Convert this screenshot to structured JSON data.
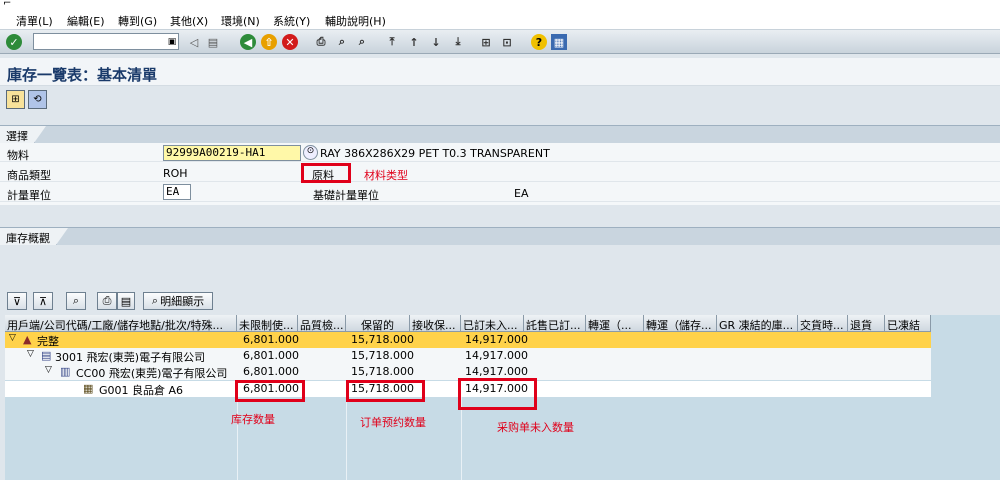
{
  "menu": [
    "清單(L)",
    "編輯(E)",
    "轉到(G)",
    "其他(X)",
    "環境(N)",
    "系統(Y)",
    "輔助說明(H)"
  ],
  "toolbar": {
    "command_field": ""
  },
  "page": {
    "title": "庫存一覽表：基本清單"
  },
  "selection": {
    "group_title": "選擇",
    "material_label": "物料",
    "material_value": "92999A00219-HA1",
    "material_desc": "RAY 386X286X29 PET T0.3 TRANSPARENT",
    "type_label": "商品類型",
    "type_value": "ROH",
    "type_text": "原料",
    "type_annotation": "材料类型",
    "unit_label": "計量單位",
    "unit_value": "EA",
    "base_unit_label": "基礎計量單位",
    "base_unit_value": "EA"
  },
  "overview": {
    "group_title": "庫存概觀",
    "detail_button": "明細顯示",
    "columns": [
      "用戶端/公司代碼/工廠/儲存地點/批次/特殊...",
      "未限制使...",
      "品質檢...",
      "保留的",
      "接收保...",
      "已訂未入...",
      "託售已訂...",
      "轉運（...",
      "轉運（儲存...",
      "GR 凍結的庫...",
      "交貨時...",
      "退貨",
      "已凍結"
    ],
    "rows": [
      {
        "label": "完整",
        "unrestricted": "6,801.000",
        "reserved": "15,718.000",
        "on_order": "14,917.000"
      },
      {
        "label": "3001 飛宏(東莞)電子有限公司",
        "unrestricted": "6,801.000",
        "reserved": "15,718.000",
        "on_order": "14,917.000"
      },
      {
        "label": "CC00 飛宏(東莞)電子有限公司",
        "unrestricted": "6,801.000",
        "reserved": "15,718.000",
        "on_order": "14,917.000"
      },
      {
        "label": "G001 良品倉 A6",
        "unrestricted": "6,801.000",
        "reserved": "15,718.000",
        "on_order": "14,917.000"
      }
    ],
    "annotations": {
      "stock": "库存数量",
      "reserved": "订单预约数量",
      "on_order": "采购单未入数量"
    }
  },
  "colors": {
    "accent_yellow": "#ffd24a",
    "annotation_red": "#e0001a"
  }
}
